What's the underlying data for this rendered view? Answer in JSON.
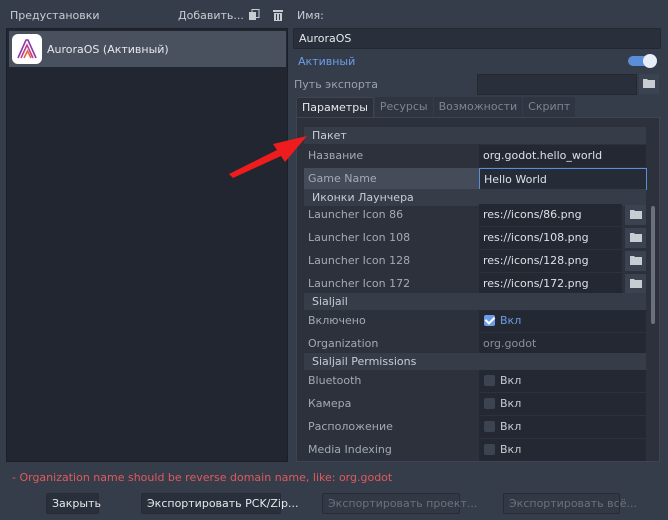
{
  "presets": {
    "header_label": "Предустановки",
    "add_label": "Добавить...",
    "items": [
      {
        "label": "AuroraOS (Активный)"
      }
    ]
  },
  "preset_detail": {
    "name_label": "Имя:",
    "name_value": "AuroraOS",
    "active_label": "Активный",
    "active_enabled": true,
    "export_path_label": "Путь экспорта",
    "export_path_value": ""
  },
  "tabs": [
    {
      "label": "Параметры",
      "active": true
    },
    {
      "label": "Ресурсы",
      "active": false
    },
    {
      "label": "Возможности",
      "active": false
    },
    {
      "label": "Скрипт",
      "active": false
    }
  ],
  "inspector": {
    "package_section": "Пакет",
    "name_row": {
      "label": "Название",
      "value": "org.godot.hello_world"
    },
    "game_name_row": {
      "label": "Game Name",
      "value": "Hello World"
    },
    "launcher_section": "Иконки Лаунчера",
    "launcher_icons": [
      {
        "label": "Launcher Icon 86",
        "value": "res://icons/86.png"
      },
      {
        "label": "Launcher Icon 108",
        "value": "res://icons/108.png"
      },
      {
        "label": "Launcher Icon 128",
        "value": "res://icons/128.png"
      },
      {
        "label": "Launcher Icon 172",
        "value": "res://icons/172.png"
      }
    ],
    "sailjail_section": "Sialjail",
    "enabled_row": {
      "label": "Включено",
      "check_label": "Вкл",
      "checked": true
    },
    "organization_row": {
      "label": "Organization",
      "value": "org.godot"
    },
    "permissions_section": "Sialjail Permissions",
    "permissions": [
      {
        "label": "Bluetooth",
        "check_label": "Вкл",
        "checked": false
      },
      {
        "label": "Камера",
        "check_label": "Вкл",
        "checked": false
      },
      {
        "label": "Расположение",
        "check_label": "Вкл",
        "checked": false
      },
      {
        "label": "Media Indexing",
        "check_label": "Вкл",
        "checked": false
      }
    ]
  },
  "error_message": "- Organization name should be reverse domain name, like: org.godot",
  "buttons": {
    "close": "Закрыть",
    "export_pck": "Экспортировать PCK/Zip...",
    "export_project": "Экспортировать проект...",
    "export_all": "Экспортировать всё..."
  },
  "colors": {
    "accent": "#6d9de6",
    "error": "#e05a5a",
    "annotation_arrow": "#ee1c1c"
  }
}
